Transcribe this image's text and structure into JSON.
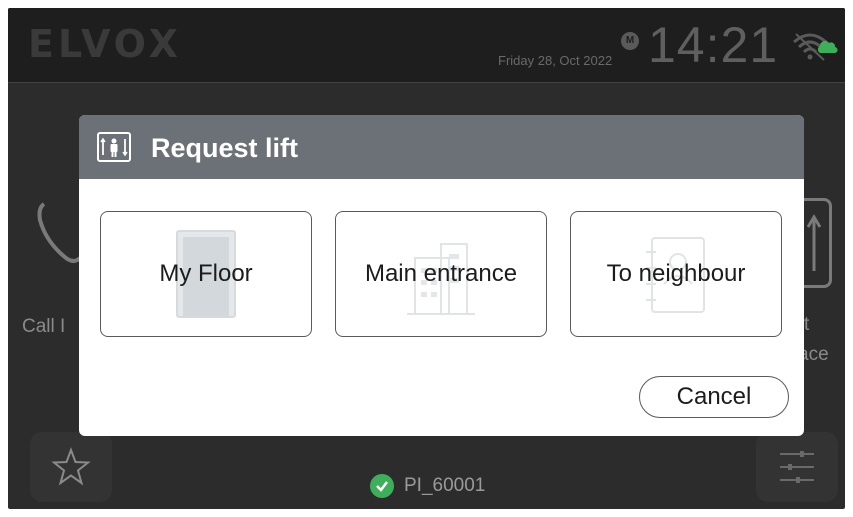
{
  "header": {
    "logo_text": "ELVOX",
    "date": "Friday 28, Oct 2022",
    "mode_badge": "M",
    "time": "14:21",
    "wifi_icon": "wifi-cloud-icon"
  },
  "background": {
    "left_label": "Call I",
    "right_label_line1": "t",
    "right_label_line2": "ace",
    "status_text": "PI_60001",
    "status_color": "#3fae5b"
  },
  "dialog": {
    "title": "Request lift",
    "title_icon": "elevator-icon",
    "header_color": "#6b7176",
    "options": [
      {
        "label": "My Floor",
        "icon": "door-icon"
      },
      {
        "label": "Main entrance",
        "icon": "building-icon"
      },
      {
        "label": "To neighbour",
        "icon": "contact-book-icon"
      }
    ],
    "cancel_label": "Cancel"
  }
}
